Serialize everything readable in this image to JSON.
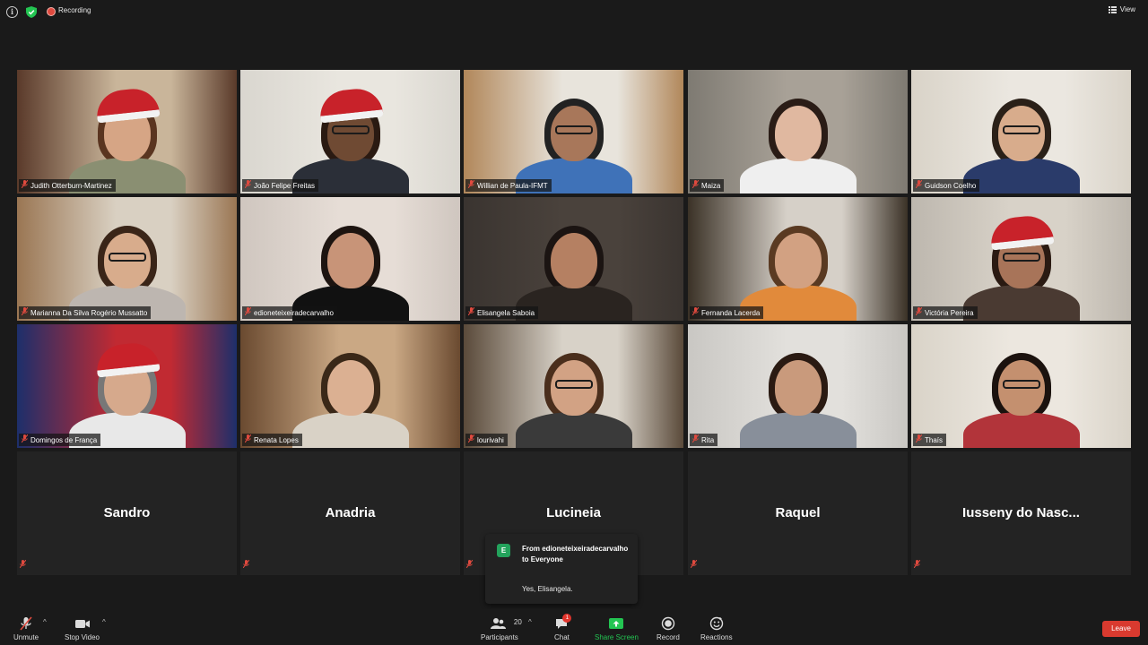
{
  "top_bar": {
    "recording_label": "Recording",
    "view_label": "View"
  },
  "video_tiles": [
    {
      "name": "Judith Otterburn-Martinez",
      "hat": true,
      "glasses": false,
      "bg": "#5a3a2a",
      "wall": "#c9b59a",
      "skin": "#d6a585",
      "hair": "#5a3520",
      "shirt": "#8a8f72"
    },
    {
      "name": "João Felipe Freitas",
      "hat": true,
      "glasses": true,
      "bg": "#d9d6cf",
      "wall": "#e9e6df",
      "skin": "#6f4a33",
      "hair": "#2a1a12",
      "shirt": "#2b2f38"
    },
    {
      "name": "Willian de Paula-IFMT",
      "hat": false,
      "glasses": true,
      "bg": "#b1875a",
      "wall": "#e8e4dc",
      "skin": "#a8775a",
      "hair": "#222222",
      "shirt": "#3f72b8"
    },
    {
      "name": "Maiza",
      "hat": false,
      "glasses": false,
      "bg": "#7e7a72",
      "wall": "#a8a197",
      "skin": "#e0b8a0",
      "hair": "#2a1c16",
      "shirt": "#efefef"
    },
    {
      "name": "Guidson Coelho",
      "hat": false,
      "glasses": true,
      "bg": "#d9d3c8",
      "wall": "#ebe7e0",
      "skin": "#d8ac8c",
      "hair": "#2a2018",
      "shirt": "#2a3b6a"
    },
    {
      "name": "Marianna Da Silva Rogério Mussatto",
      "hat": false,
      "glasses": true,
      "bg": "#9a7653",
      "wall": "#d9d0c2",
      "skin": "#d8ac8c",
      "hair": "#3a2518",
      "shirt": "#bdb6b0"
    },
    {
      "name": "edioneteixeiradecarvalho",
      "hat": false,
      "glasses": false,
      "bg": "#cfc6bf",
      "wall": "#e6ddd6",
      "skin": "#c89478",
      "hair": "#1d1410",
      "shirt": "#111111"
    },
    {
      "name": "Elisangela Saboia",
      "hat": false,
      "glasses": false,
      "bg": "#3a3430",
      "wall": "#4a423c",
      "skin": "#b58062",
      "hair": "#1b1412",
      "shirt": "#2a2420"
    },
    {
      "name": "Fernanda Lacerda",
      "hat": false,
      "glasses": false,
      "bg": "#3b3227",
      "wall": "#d6d0c8",
      "skin": "#d2a182",
      "hair": "#5a3a22",
      "shirt": "#e18a3b"
    },
    {
      "name": "Victória Pereira",
      "hat": true,
      "glasses": true,
      "bg": "#bdb7ae",
      "wall": "#d8d2c8",
      "skin": "#a87459",
      "hair": "#2a1a12",
      "shirt": "#4a3a32"
    },
    {
      "name": "Domingos de França",
      "hat": true,
      "glasses": false,
      "bg": "#1d2f6b",
      "wall": "#c12a32",
      "skin": "#d6a98c",
      "hair": "#777777",
      "shirt": "#e8e8e8"
    },
    {
      "name": "Renata Lopes",
      "hat": false,
      "glasses": false,
      "bg": "#6a4a30",
      "wall": "#caa884",
      "skin": "#dbb092",
      "hair": "#3a2818",
      "shirt": "#d9d2c6"
    },
    {
      "name": "lourivahi",
      "hat": false,
      "glasses": true,
      "bg": "#5a4a3a",
      "wall": "#d8d2c8",
      "skin": "#d2a284",
      "hair": "#4a2e1c",
      "shirt": "#3a3a3a"
    },
    {
      "name": "Rita",
      "hat": false,
      "glasses": false,
      "bg": "#c9c7c3",
      "wall": "#e2e0dc",
      "skin": "#c99a7c",
      "hair": "#2a1a12",
      "shirt": "#888f9a"
    },
    {
      "name": "Thaís",
      "hat": false,
      "glasses": true,
      "bg": "#d9d3c8",
      "wall": "#ece7df",
      "skin": "#c4906f",
      "hair": "#1b120e",
      "shirt": "#b2343a"
    }
  ],
  "name_tiles": [
    {
      "name": "Sandro"
    },
    {
      "name": "Anadria"
    },
    {
      "name": "Lucineia"
    },
    {
      "name": "Raquel"
    },
    {
      "name": "Iusseny do Nasc..."
    }
  ],
  "chat_toast": {
    "avatar_letter": "E",
    "header": "From edioneteixeiradecarvalho to Everyone",
    "message": "Yes, Elisangela."
  },
  "toolbar": {
    "unmute_label": "Unmute",
    "stop_video_label": "Stop Video",
    "participants_label": "Participants",
    "participants_count": "20",
    "chat_label": "Chat",
    "chat_badge": "1",
    "share_screen_label": "Share Screen",
    "record_label": "Record",
    "reactions_label": "Reactions",
    "leave_label": "Leave"
  },
  "colors": {
    "background": "#1a1a1a",
    "active_speaker_border": "#e2e574",
    "share_screen_green": "#23c552",
    "leave_red": "#d93a2f",
    "muted_red": "#e04a3f"
  }
}
